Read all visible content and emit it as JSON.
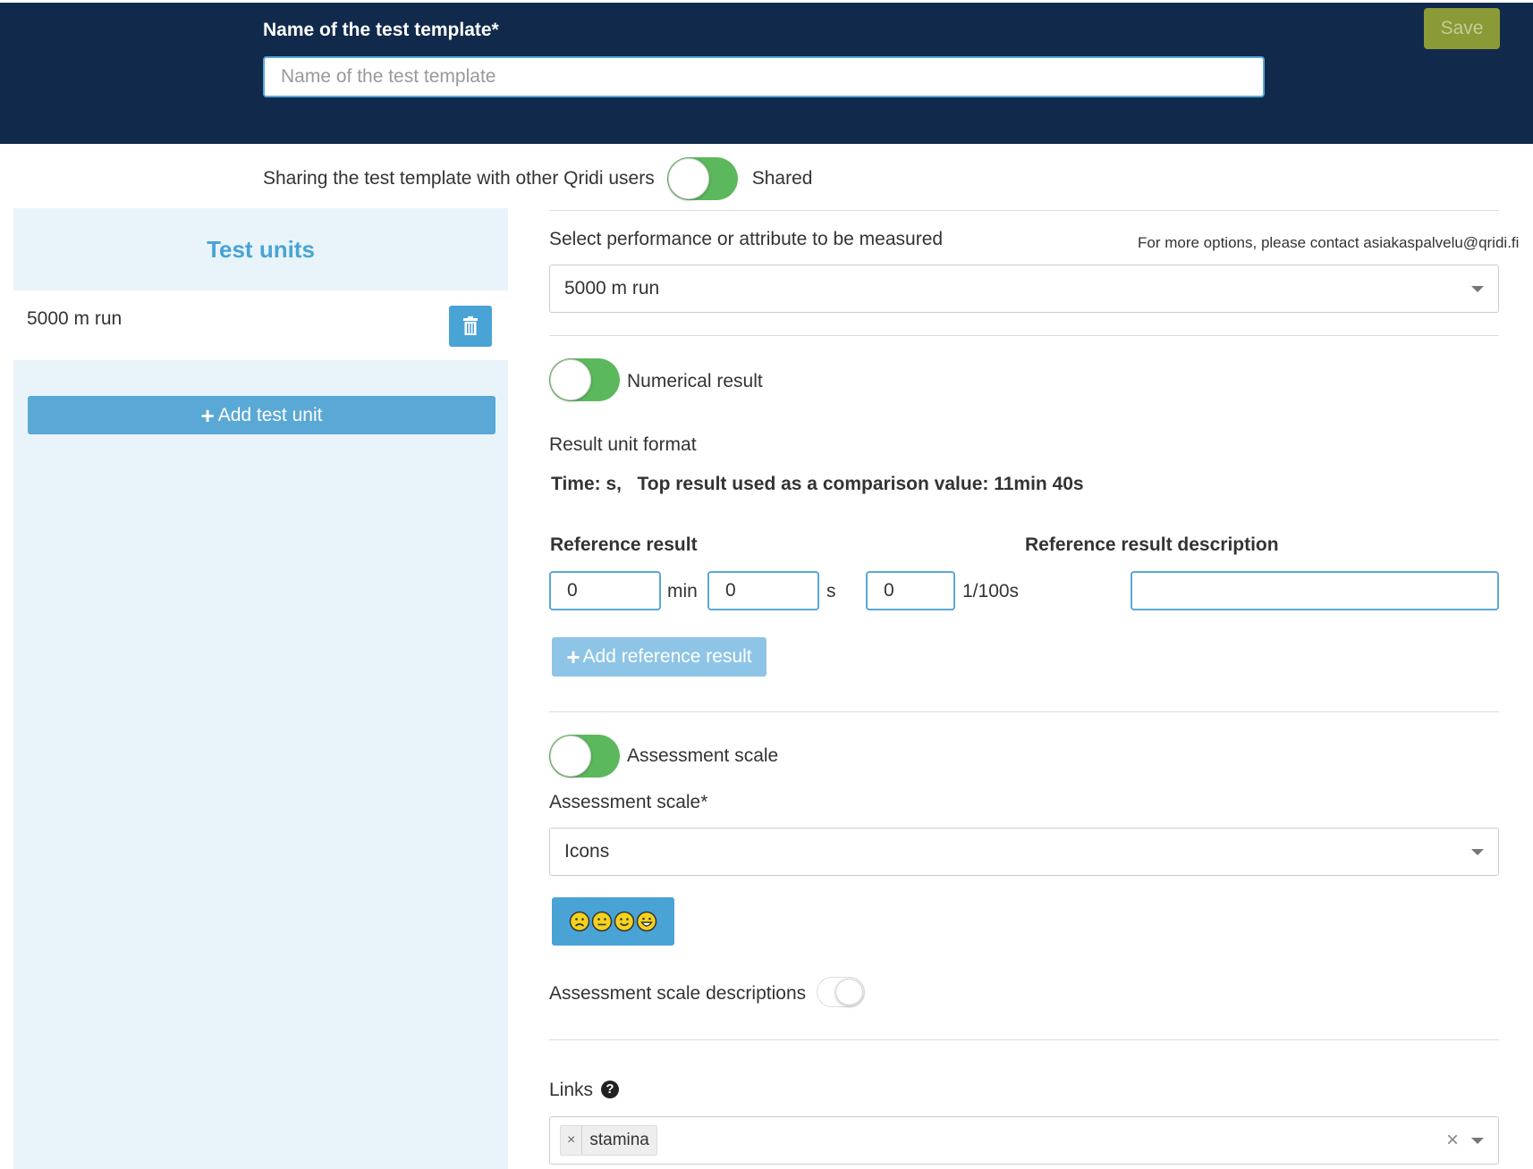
{
  "header": {
    "name_label": "Name of the test template*",
    "name_placeholder": "Name of the test template",
    "name_value": "",
    "save_label": "Save"
  },
  "sharing": {
    "label": "Sharing the test template with other Qridi users",
    "state_label": "Shared",
    "on": true
  },
  "sidebar": {
    "title": "Test units",
    "units": [
      {
        "label": "5000 m run"
      }
    ],
    "add_label": "Add test unit"
  },
  "measure": {
    "label": "Select performance or attribute to be measured",
    "note": "For more options, please contact asiakaspalvelu@qridi.fi",
    "selected": "5000 m run"
  },
  "numerical": {
    "toggle_label": "Numerical result",
    "on": true,
    "result_unit_label": "Result unit format",
    "result_unit_value": "Time: s,   Top result used as a comparison value: 11min 40s",
    "reference_result_label": "Reference result",
    "reference_desc_label": "Reference result description",
    "min_value": "0",
    "min_unit": "min",
    "sec_value": "0",
    "sec_unit": "s",
    "hundredth_value": "0",
    "hundredth_unit": "1/100s",
    "description_value": "",
    "add_reference_label": "Add reference result"
  },
  "assessment": {
    "toggle_label": "Assessment scale",
    "on": true,
    "scale_label": "Assessment scale*",
    "scale_selected": "Icons",
    "icons": [
      "sad-face-icon",
      "neutral-face-icon",
      "smile-face-icon",
      "grin-face-icon"
    ],
    "descriptions_label": "Assessment scale descriptions",
    "descriptions_on": false
  },
  "links": {
    "label": "Links",
    "tags": [
      "stamina"
    ]
  },
  "colors": {
    "header_bg": "#112a4c",
    "accent": "#4aa3d5",
    "toggle_on": "#5cb85c",
    "save_bg": "#8a9a36",
    "sidebar_bg": "#e8f4f9",
    "face_fill": "#f5d21c"
  }
}
